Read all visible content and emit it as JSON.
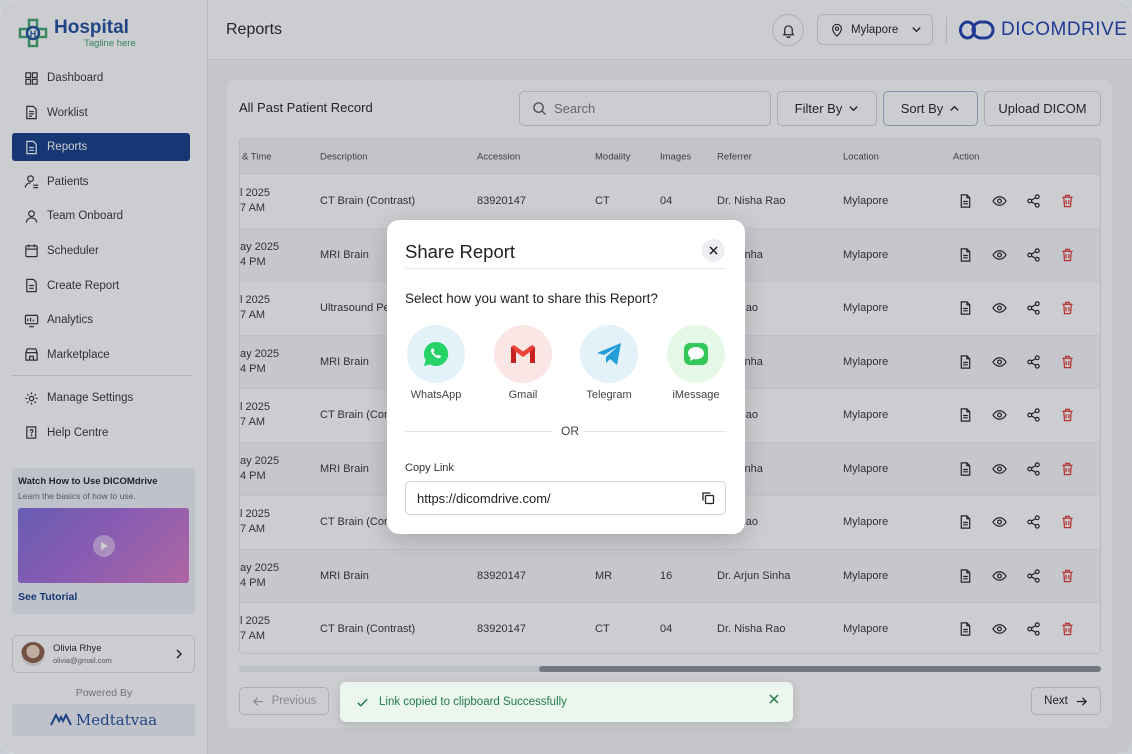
{
  "sidebar": {
    "logo_title": "Hospital",
    "logo_tagline": "Tagline here",
    "items": [
      {
        "label": "Dashboard",
        "icon": "grid-icon"
      },
      {
        "label": "Worklist",
        "icon": "document-list-icon"
      },
      {
        "label": "Reports",
        "icon": "report-icon",
        "active": true
      },
      {
        "label": "Patients",
        "icon": "user-icon"
      },
      {
        "label": "Team Onboard",
        "icon": "team-icon"
      },
      {
        "label": "Scheduler",
        "icon": "calendar-icon"
      },
      {
        "label": "Create Report",
        "icon": "create-doc-icon"
      },
      {
        "label": "Analytics",
        "icon": "analytics-icon"
      },
      {
        "label": "Marketplace",
        "icon": "marketplace-icon"
      }
    ],
    "bottom_items": [
      {
        "label": "Manage Settings",
        "icon": "gear-icon"
      },
      {
        "label": "Help Centre",
        "icon": "help-book-icon"
      }
    ],
    "tutorial": {
      "title": "Watch How to Use DICOMdrive",
      "subtitle": "Learn the basics of how to use.",
      "link": "See Tutorial"
    },
    "user": {
      "name": "Olivia Rhye",
      "email": "olivia@gmail.com"
    },
    "powered_by": "Powered By",
    "powered_brand": "Medtatvaa"
  },
  "topbar": {
    "title": "Reports",
    "location": "Mylapore",
    "brand": "DICOMDRIVE"
  },
  "main": {
    "card_title": "All Past Patient Record",
    "search_placeholder": "Search",
    "filter_label": "Filter By",
    "sort_label": "Sort By",
    "upload_label": "Upload DICOM",
    "columns": [
      "& Time",
      "Description",
      "Accession",
      "Modality",
      "Images",
      "Referrer",
      "Location",
      "Action"
    ],
    "rows": [
      {
        "date": "l 2025",
        "time": "7 AM",
        "description": "CT Brain (Contrast)",
        "accession": "83920147",
        "modality": "CT",
        "images": "04",
        "referrer": "Dr. Nisha Rao",
        "location": "Mylapore"
      },
      {
        "date": "ay 2025",
        "time": "4 PM",
        "description": "MRI Brain",
        "accession": "",
        "modality": "",
        "images": "",
        "referrer": "jun Sinha",
        "location": "Mylapore"
      },
      {
        "date": "l 2025",
        "time": "7 AM",
        "description": "Ultrasound Pe",
        "accession": "",
        "modality": "",
        "images": "",
        "referrer": "sha Rao",
        "location": "Mylapore"
      },
      {
        "date": "ay 2025",
        "time": "4 PM",
        "description": "MRI Brain",
        "accession": "",
        "modality": "",
        "images": "",
        "referrer": "jun Sinha",
        "location": "Mylapore"
      },
      {
        "date": "l 2025",
        "time": "7 AM",
        "description": "CT Brain (Con",
        "accession": "",
        "modality": "",
        "images": "",
        "referrer": "sha Rao",
        "location": "Mylapore"
      },
      {
        "date": "ay 2025",
        "time": "4 PM",
        "description": "MRI Brain",
        "accession": "",
        "modality": "",
        "images": "",
        "referrer": "jun Sinha",
        "location": "Mylapore"
      },
      {
        "date": "l 2025",
        "time": "7 AM",
        "description": "CT Brain (Con",
        "accession": "",
        "modality": "",
        "images": "",
        "referrer": "sha Rao",
        "location": "Mylapore"
      },
      {
        "date": "ay 2025",
        "time": "4 PM",
        "description": "MRI Brain",
        "accession": "83920147",
        "modality": "MR",
        "images": "16",
        "referrer": "Dr. Arjun Sinha",
        "location": "Mylapore"
      },
      {
        "date": "l 2025",
        "time": "7 AM",
        "description": "CT Brain (Contrast)",
        "accession": "83920147",
        "modality": "CT",
        "images": "04",
        "referrer": "Dr. Nisha Rao",
        "location": "Mylapore"
      }
    ],
    "previous_label": "Previous",
    "next_label": "Next"
  },
  "modal": {
    "title": "Share Report",
    "subtitle": "Select how you want to share this Report?",
    "options": [
      {
        "label": "WhatsApp",
        "icon": "whatsapp-icon",
        "bg": "#e3f1f8"
      },
      {
        "label": "Gmail",
        "icon": "gmail-icon",
        "bg": "#fbe6e6"
      },
      {
        "label": "Telegram",
        "icon": "telegram-icon",
        "bg": "#e3f1f8"
      },
      {
        "label": "iMessage",
        "icon": "imessage-icon",
        "bg": "#e5f8e6"
      }
    ],
    "or_text": "OR",
    "copy_label": "Copy Link",
    "copy_value": "https://dicomdrive.com/"
  },
  "toast": {
    "message": "Link copied to clipboard Successfully"
  },
  "colors": {
    "primary": "#0f3b86",
    "danger": "#e0342f",
    "success": "#237a44"
  }
}
